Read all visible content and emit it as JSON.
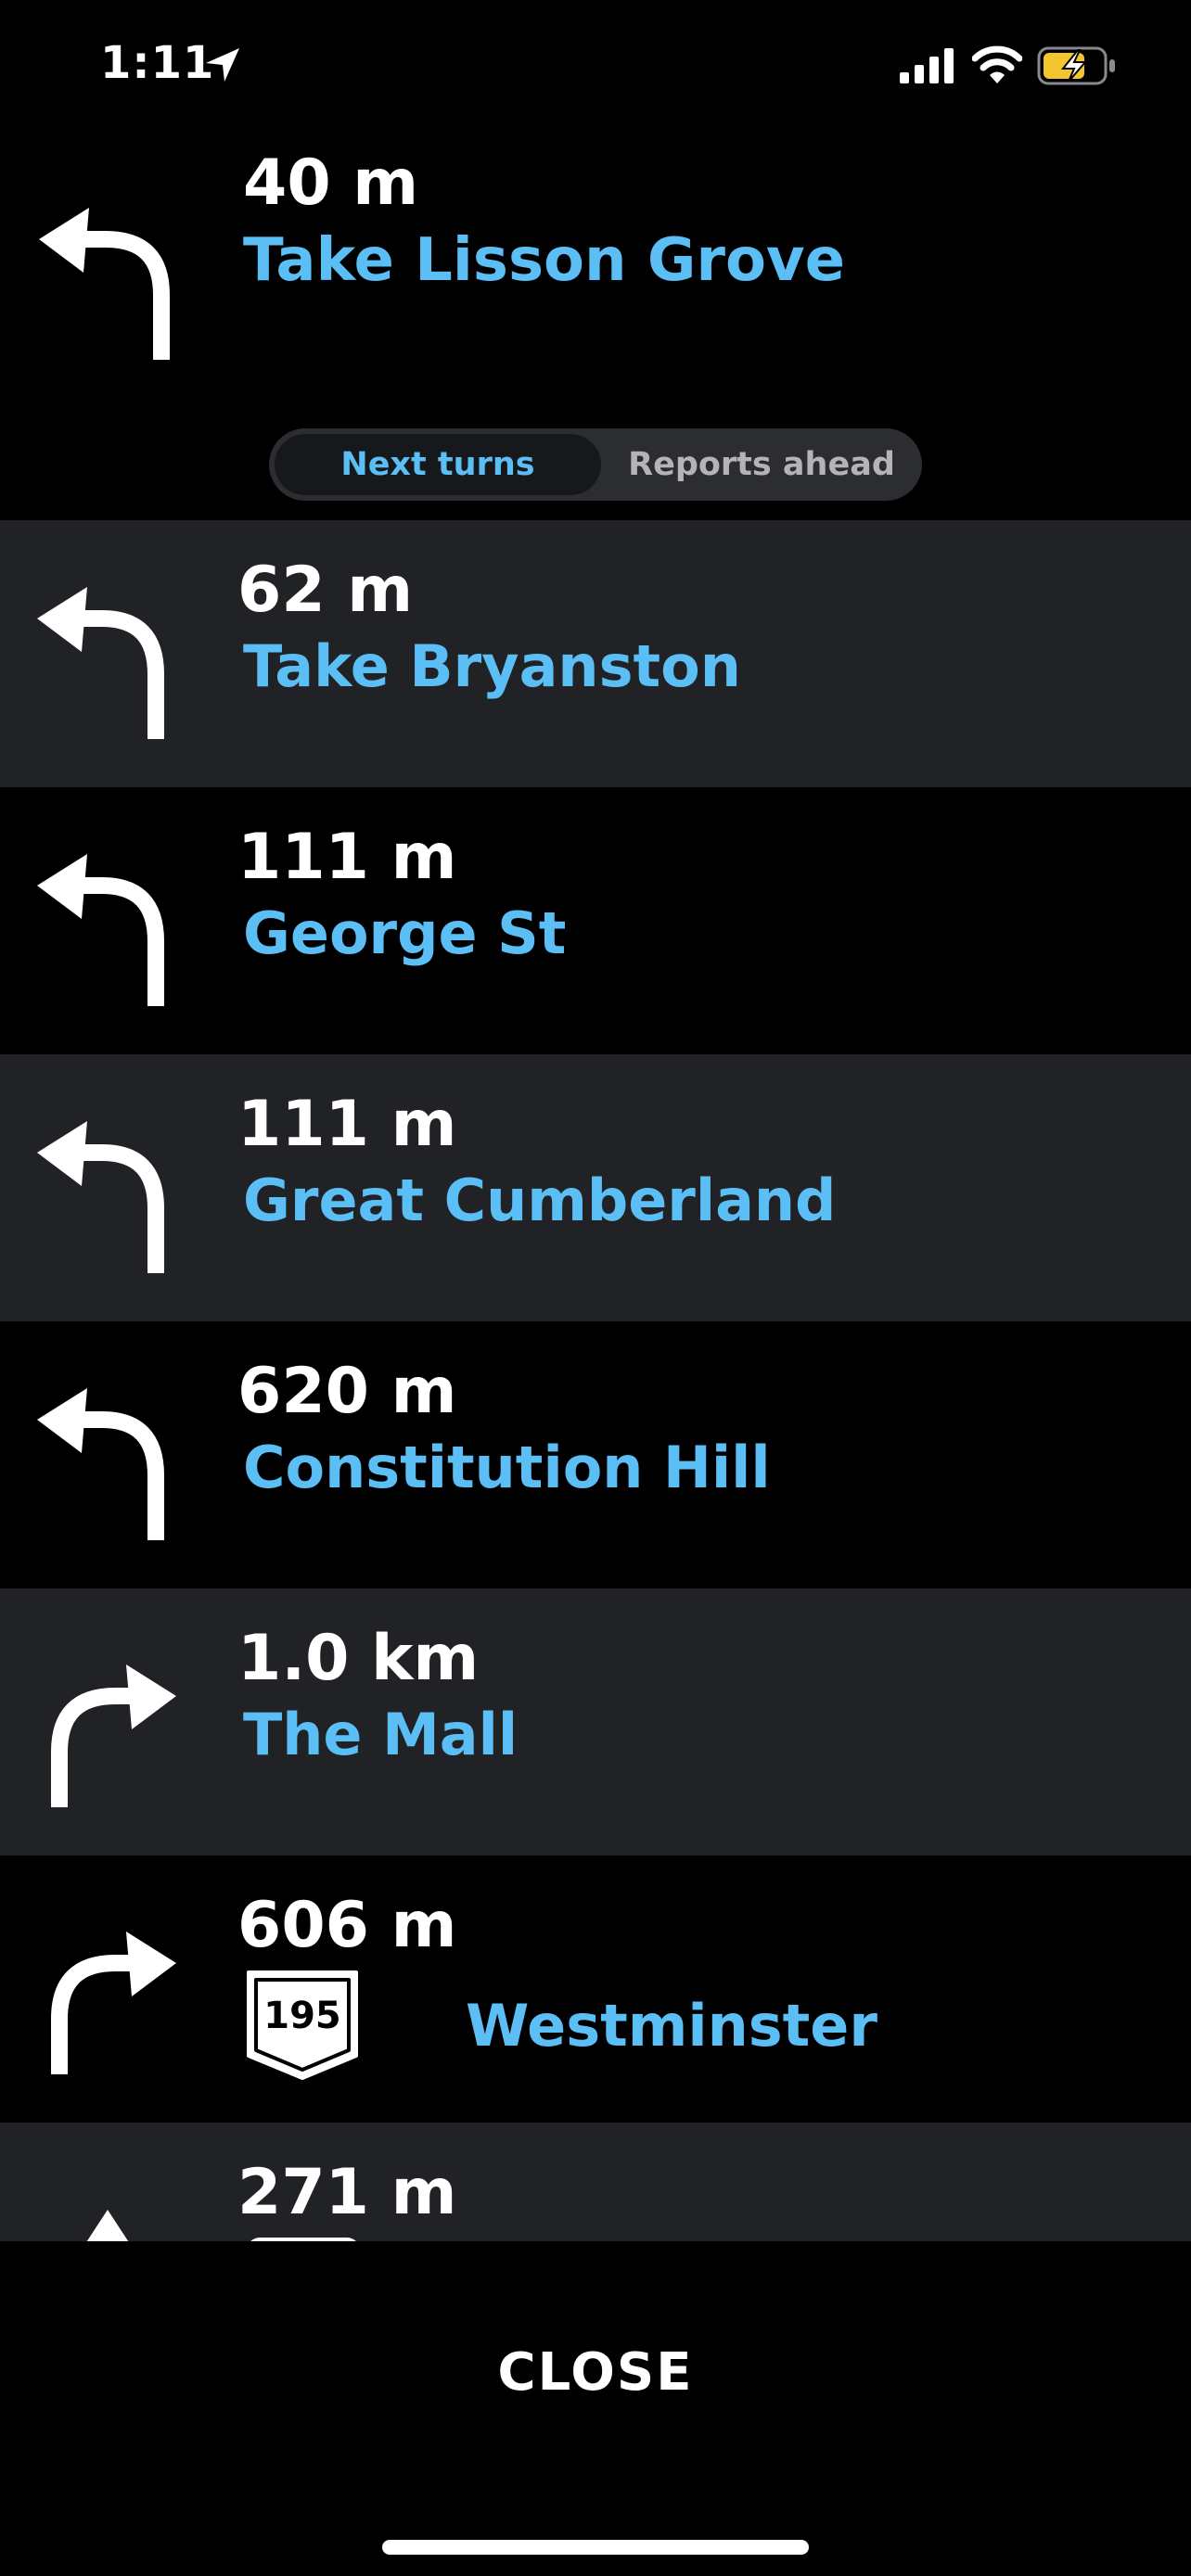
{
  "status": {
    "time": "1:11",
    "battery_color": "#F5C530"
  },
  "current": {
    "distance": "40 m",
    "street": "Take Lisson Grove",
    "direction": "left"
  },
  "tabs": {
    "next_turns": "Next turns",
    "reports_ahead": "Reports ahead",
    "selected": "next_turns"
  },
  "turns": [
    {
      "distance": "62 m",
      "street": "Take Bryanston",
      "direction": "left"
    },
    {
      "distance": "111 m",
      "street": "George St",
      "direction": "left"
    },
    {
      "distance": "111 m",
      "street": "Great Cumberland",
      "direction": "left"
    },
    {
      "distance": "620 m",
      "street": "Constitution Hill",
      "direction": "left"
    },
    {
      "distance": "1.0 km",
      "street": "The Mall",
      "direction": "right"
    },
    {
      "distance": "606 m",
      "shield": "195",
      "street": "Westminster",
      "direction": "right"
    },
    {
      "distance": "271 m",
      "direction": "straight"
    }
  ],
  "footer": {
    "close_label": "CLOSE"
  },
  "colors": {
    "accent": "#5BBEF5",
    "row_alt": "#212226",
    "background": "#000000"
  }
}
